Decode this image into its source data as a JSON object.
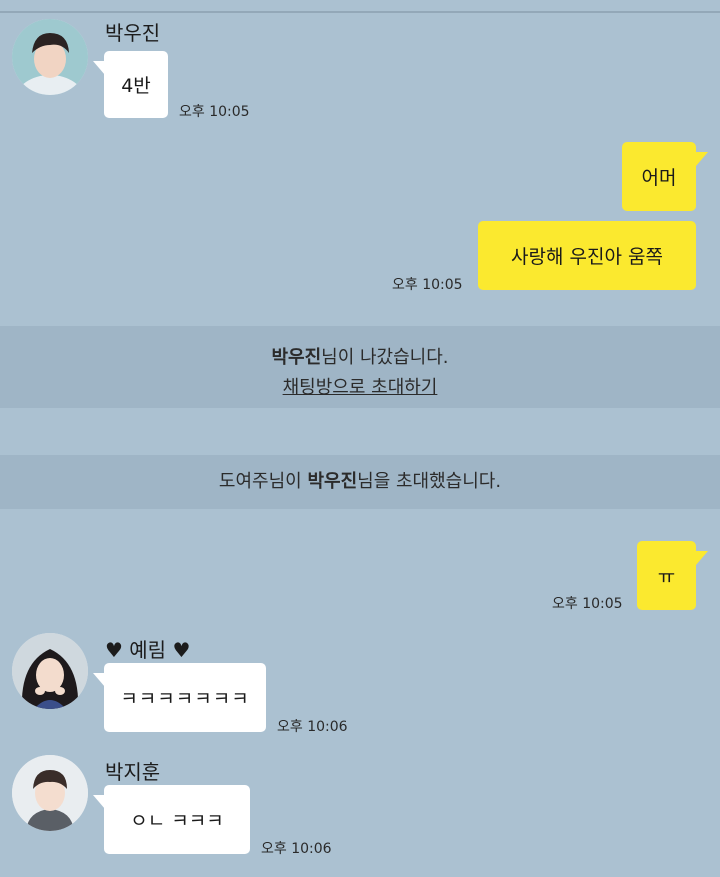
{
  "messages": {
    "m1": {
      "sender": "박우진",
      "text": "4반",
      "time": "오후 10:05"
    },
    "m2": {
      "text": "어머"
    },
    "m3": {
      "text": "사랑해 우진아 움쪽",
      "time": "오후 10:05"
    },
    "m4": {
      "text": "ㅠ",
      "time": "오후 10:05"
    },
    "m5": {
      "sender": "♥ 예림 ♥",
      "text": "ㅋㅋㅋㅋㅋㅋㅋ",
      "time": "오후 10:06"
    },
    "m6": {
      "sender": "박지훈",
      "text": "ㅇㄴ ㅋㅋㅋ",
      "time": "오후 10:06"
    }
  },
  "notices": {
    "left": {
      "name": "박우진",
      "suffix": "님이 나갔습니다.",
      "invite_link": "채팅방으로 초대하기"
    },
    "invited": {
      "prefix": "도여주님이 ",
      "name": "박우진",
      "suffix": "님을 초대했습니다."
    }
  },
  "colors": {
    "background": "#abc1d1",
    "notice_band": "#9fb5c6",
    "my_bubble": "#fbe92f",
    "other_bubble": "#ffffff"
  }
}
